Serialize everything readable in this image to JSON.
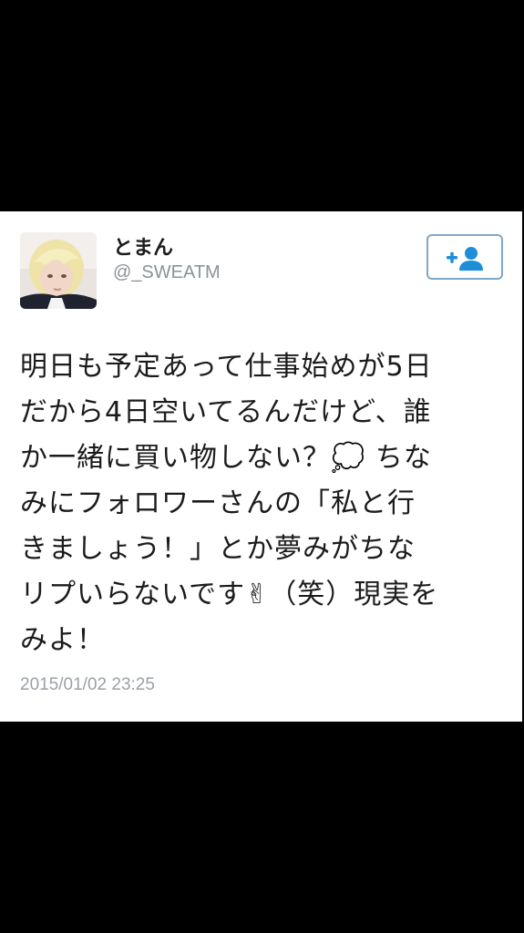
{
  "tweet": {
    "author": {
      "display_name": "とまん",
      "handle": "@_SWEATM",
      "avatar_icon": "profile-photo"
    },
    "follow_button": {
      "icon": "add-user-icon"
    },
    "text_lines": [
      "明日も予定あって仕事始めが5日",
      "だから4日空いてるんだけど、誰",
      "か一緒に買い物しない？💭 ちな",
      "みにフォロワーさんの「私と行",
      "きましょう！」とか夢みがちな",
      "リプいらないです✌（笑）現実を",
      "みよ！"
    ],
    "timestamp": "2015/01/02 23:25"
  },
  "colors": {
    "background": "#000000",
    "card": "#ffffff",
    "text": "#1b1b1b",
    "handle": "#8a929b",
    "accent": "#1d8ed8",
    "button_border": "#7fa6c8"
  }
}
